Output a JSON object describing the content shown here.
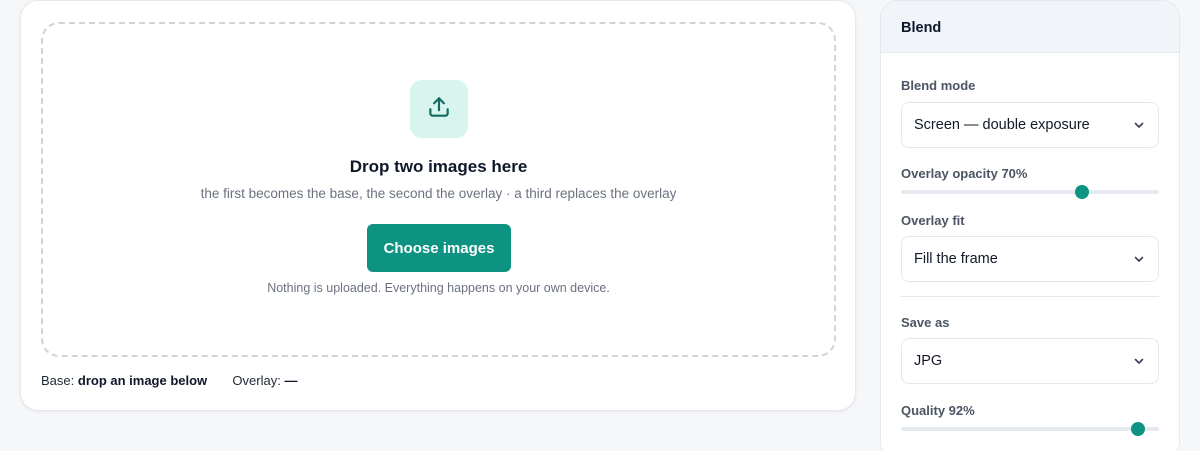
{
  "dropzone": {
    "title": "Drop two images here",
    "subtitle": "the first becomes the base, the second the overlay · a third replaces the overlay",
    "button_label": "Choose images",
    "note": "Nothing is uploaded. Everything happens on your own device.",
    "icon": "upload-icon"
  },
  "status": {
    "base_label": "Base:",
    "base_value": "drop an image below",
    "overlay_label": "Overlay:",
    "overlay_value": "—"
  },
  "panel": {
    "title": "Blend",
    "blend_mode": {
      "label": "Blend mode",
      "value": "Screen — double exposure"
    },
    "overlay_opacity": {
      "label": "Overlay opacity 70%",
      "value": 0.7
    },
    "overlay_fit": {
      "label": "Overlay fit",
      "value": "Fill the frame"
    },
    "save_as": {
      "label": "Save as",
      "value": "JPG"
    },
    "quality": {
      "label": "Quality 92%",
      "value": 0.92
    }
  },
  "colors": {
    "accent": "#0e9383",
    "icon_tile": "#d7f4ee"
  }
}
